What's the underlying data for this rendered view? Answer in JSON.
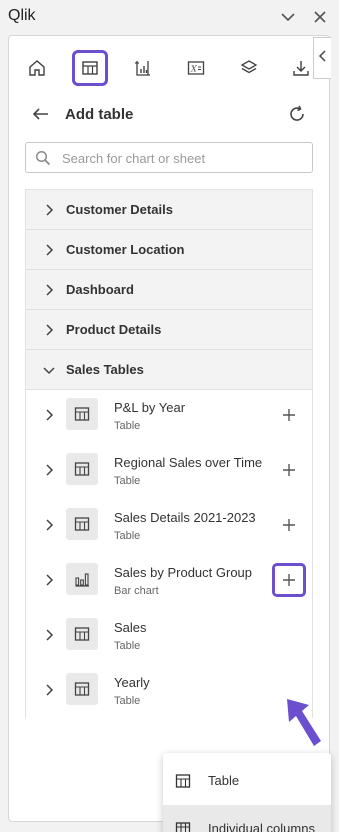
{
  "window": {
    "title": "Qlik"
  },
  "toolbar": {
    "icons": [
      "home-icon",
      "table-icon",
      "chart-icon",
      "formula-icon",
      "layers-icon",
      "download-icon"
    ],
    "selected": "table-icon",
    "accent": "#6b4fcf"
  },
  "header": {
    "title": "Add table"
  },
  "search": {
    "placeholder": "Search for chart or sheet",
    "value": ""
  },
  "sections": [
    {
      "label": "Customer Details",
      "expanded": false
    },
    {
      "label": "Customer Location",
      "expanded": false
    },
    {
      "label": "Dashboard",
      "expanded": false
    },
    {
      "label": "Product Details",
      "expanded": false
    },
    {
      "label": "Sales Tables",
      "expanded": true
    }
  ],
  "items": [
    {
      "name": "P&L by Year",
      "type": "Table",
      "icon": "table-icon"
    },
    {
      "name": "Regional Sales over Time",
      "type": "Table",
      "icon": "table-icon"
    },
    {
      "name": "Sales Details 2021-2023",
      "type": "Table",
      "icon": "table-icon"
    },
    {
      "name": "Sales by Product Group",
      "type": "Bar chart",
      "icon": "bar-chart-icon"
    },
    {
      "name": "Sales",
      "type": "Table",
      "icon": "table-icon"
    },
    {
      "name": "Yearly",
      "type": "Table",
      "icon": "table-icon"
    }
  ],
  "menu": {
    "items": [
      {
        "label": "Table",
        "icon": "table-icon"
      },
      {
        "label": "Individual columns",
        "icon": "columns-icon"
      }
    ]
  }
}
